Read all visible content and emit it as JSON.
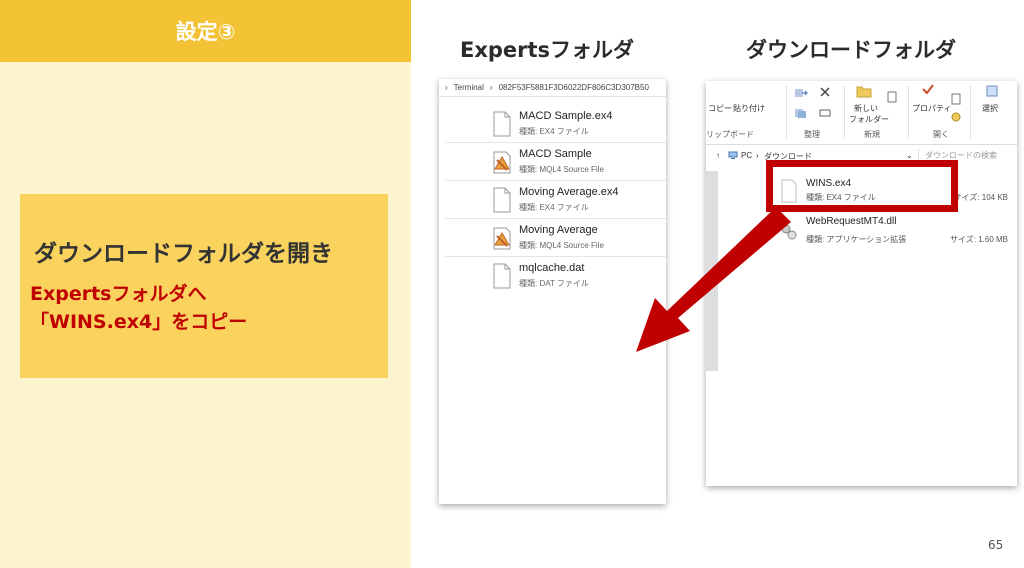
{
  "header": {
    "title": "設定③"
  },
  "callout": {
    "title": "ダウンロードフォルダを開き",
    "line1": "Expertsフォルダへ",
    "line2": "「WINS.ex4」をコピー"
  },
  "experts_pane": {
    "label": "Expertsフォルダ",
    "breadcrumb": [
      "Terminal",
      "082F53F5881F3D6022DF806C3D307B50"
    ],
    "files": [
      {
        "name": "MACD Sample.ex4",
        "type": "種類: EX4 ファイル",
        "icon": "blank-file-icon"
      },
      {
        "name": "MACD Sample",
        "type": "種類: MQL4 Source File",
        "icon": "mql4-source-icon"
      },
      {
        "name": "Moving Average.ex4",
        "type": "種類: EX4 ファイル",
        "icon": "blank-file-icon"
      },
      {
        "name": "Moving Average",
        "type": "種類: MQL4 Source File",
        "icon": "mql4-source-icon"
      },
      {
        "name": "mqlcache.dat",
        "type": "種類: DAT ファイル",
        "icon": "blank-file-icon"
      }
    ]
  },
  "downloads_pane": {
    "label": "ダウンロードフォルダ",
    "ribbon": {
      "copy": "コピー",
      "paste": "貼り付け",
      "clipboard_group": "リップボード",
      "organize_group": "整理",
      "new_folder": "新しい",
      "new_folder2": "フォルダー",
      "new_group": "新規",
      "properties": "プロパティ",
      "open_group": "開く",
      "select": "選択"
    },
    "nav": {
      "root": "PC",
      "folder": "ダウンロード",
      "search_placeholder": "ダウンロードの検索"
    },
    "files": [
      {
        "name": "WINS.ex4",
        "type": "種類: EX4 ファイル",
        "size": "サイズ: 104 KB",
        "icon": "blank-file-icon"
      },
      {
        "name": "WebRequestMT4.dll",
        "type": "種類: アプリケーション拡張",
        "size": "サイズ: 1.60 MB",
        "icon": "dll-file-icon"
      }
    ]
  },
  "colors": {
    "header": "#f3c335",
    "panel": "#fdf3cf",
    "callout": "#fad35e",
    "accent_red": "#c00000"
  },
  "page_number": "65"
}
